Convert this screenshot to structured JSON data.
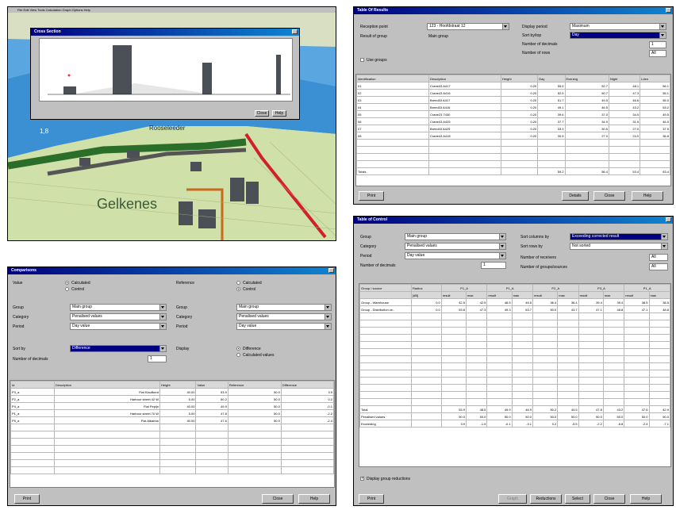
{
  "map_window": {
    "menubar": "File Edit View Tools Calculation Graph Options Help",
    "chart_dialog_title": "Cross Section",
    "chart_ok": "Close",
    "chart_help": "Help",
    "place_labels": [
      "Rooseleeder",
      "Gelkenes"
    ],
    "map_number": "1,8"
  },
  "results_window": {
    "title": "Table Of Results",
    "reception_point_label": "Reception point",
    "reception_point_value": "123 - Hoofdstraat 12",
    "result_group_label": "Result of group",
    "result_group_value": "Main group",
    "display_period_label": "Display period",
    "display_period_value": "Maximum",
    "sort_by_label": "Sort by/top",
    "sort_by_value": "Day",
    "decimals_label": "Number of decimals",
    "decimals_value": "1",
    "rows_label": "Number of rows",
    "rows_value": "All",
    "use_groups_label": "Use groups",
    "columns": [
      "Identification",
      "Description",
      "Height",
      "Day",
      "Evening",
      "Night",
      "Lden"
    ],
    "rows": [
      [
        "01",
        "Crane43 A417",
        "0.20",
        "55.5",
        "52.7",
        "48.1",
        "56.1"
      ],
      [
        "02",
        "Crane43 A416",
        "0.20",
        "52.5",
        "50.7",
        "47.3",
        "55.1"
      ],
      [
        "03",
        "Breed33 A417",
        "0.20",
        "51.7",
        "49.5",
        "46.6",
        "55.0"
      ],
      [
        "04",
        "Breed33 A416",
        "0.20",
        "49.1",
        "46.5",
        "43.2",
        "53.2"
      ],
      [
        "05",
        "Crane23 7430",
        "0.20",
        "39.6",
        "37.0",
        "34.0",
        "49.5"
      ],
      [
        "06",
        "Crane43 A425",
        "0.20",
        "37.7",
        "34.9",
        "31.9",
        "46.5"
      ],
      [
        "07",
        "Breed43 A425",
        "0.20",
        "33.3",
        "30.5",
        "27.0",
        "37.5"
      ],
      [
        "08",
        "Crane43 A418",
        "0.20",
        "30.5",
        "27.0",
        "24.0",
        "36.8"
      ]
    ],
    "total_label": "Totals",
    "totals": [
      "59.2",
      "56.4",
      "53.4",
      "63.4"
    ],
    "print_btn": "Print",
    "details_btn": "Details",
    "close_btn": "Close",
    "help_btn": "Help"
  },
  "comparison_window": {
    "title": "Comparisons",
    "value_label": "Value",
    "value_opt1": "Calculated",
    "value_opt2": "Control",
    "reference_label": "Reference",
    "ref_opt1": "Calculated",
    "ref_opt2": "Control",
    "group_label": "Group",
    "group_value": "Main group",
    "category_label": "Category",
    "category_value": "Penalised values",
    "period_label": "Period",
    "period_value": "Day value",
    "rgroup_label": "Group",
    "rgroup_value": "Main group",
    "rcategory_label": "Category",
    "rcategory_value": "Penalised values",
    "rperiod_label": "Period",
    "rperiod_value": "Day value",
    "sort_label": "Sort by",
    "sort_value": "Difference",
    "decimals_label": "Number of decimals",
    "decimals_value": "1",
    "display_label": "Display",
    "display_opt1": "Difference",
    "display_opt2": "Calculated values",
    "columns": [
      "Id",
      "Description",
      "Height",
      "Value",
      "Reference",
      "Difference"
    ],
    "rows": [
      [
        "P3_a",
        "Flat Klaufberd",
        "40.00",
        "53.9",
        "50.0",
        "3.9"
      ],
      [
        "P2_a",
        "Harbour street 42 W",
        "5.00",
        "50.2",
        "50.0",
        "0.2"
      ],
      [
        "P4_a",
        "Flat Pepijn",
        "40.00",
        "49.9",
        "50.0",
        "-0.1"
      ],
      [
        "P1_a",
        "Harbour street 70 W",
        "5.00",
        "47.8",
        "50.0",
        "-2.2"
      ],
      [
        "P5_a",
        "Flat Albatros",
        "40.00",
        "47.6",
        "50.0",
        "-2.4"
      ]
    ],
    "print_btn": "Print",
    "close_btn": "Close",
    "help_btn": "Help"
  },
  "control_window": {
    "title": "Table of Control",
    "group_label": "Group",
    "group_value": "Main group",
    "category_label": "Category",
    "category_value": "Penalised values",
    "period_label": "Period",
    "period_value": "Day value",
    "decimals_label": "Number of decimals",
    "decimals_value": "1",
    "sort_label": "Sort columns by",
    "sort_value": "Exceeding corrected result",
    "sort_rows_label": "Sort rows by",
    "sort_rows_value": "Not sorted",
    "num_receivers_label": "Number of receivers",
    "num_receivers_value": "All",
    "num_groups_label": "Number of groups/sources",
    "num_groups_value": "All",
    "col_header1": "Group / source",
    "col_header2": "Radius",
    "point_headers": [
      "P1_A",
      "P1_A",
      "P2_A",
      "P3_A",
      "P1_A"
    ],
    "sub_headers": [
      "result",
      "max",
      "result",
      "max",
      "result",
      "max",
      "result",
      "max",
      "result",
      "max"
    ],
    "unit": "[dB]",
    "rows": [
      [
        "Group - Warehouse",
        "0.0",
        "42.5",
        "42.5",
        "48.5",
        "46.5",
        "36.4",
        "36.4",
        "39.4",
        "39.4",
        "38.5",
        "38.5"
      ],
      [
        "Group - Distribution ce..",
        "0.0",
        "53.8",
        "47.3",
        "49.3",
        "63.7",
        "50.0",
        "43.7",
        "47.1",
        "48.8",
        "47.1",
        "48.8"
      ]
    ],
    "total_label": "Total",
    "total_row": [
      "53.9",
      "48.5",
      "49.9",
      "46.9",
      "50.2",
      "44.5",
      "47.8",
      "43.2",
      "47.6",
      "42.9"
    ],
    "penalised_label": "Penalised values",
    "penalised_row": [
      "50.0",
      "50.0",
      "50.0",
      "50.0",
      "50.0",
      "50.0",
      "50.0",
      "50.0",
      "50.0",
      "50.0"
    ],
    "exceeding_label": "Exceeding",
    "exceeding_row": [
      "3.9",
      "-1.5",
      "-0.1",
      "-3.1",
      "0.2",
      "-5.5",
      "-2.2",
      "-6.8",
      "-2.4",
      "-7.1"
    ],
    "display_reductions_label": "Display group reductions",
    "print_btn": "Print",
    "graph_btn": "Graph",
    "reductions_btn": "Reductions",
    "select_btn": "Select",
    "close_btn": "Close",
    "help_btn": "Help"
  }
}
